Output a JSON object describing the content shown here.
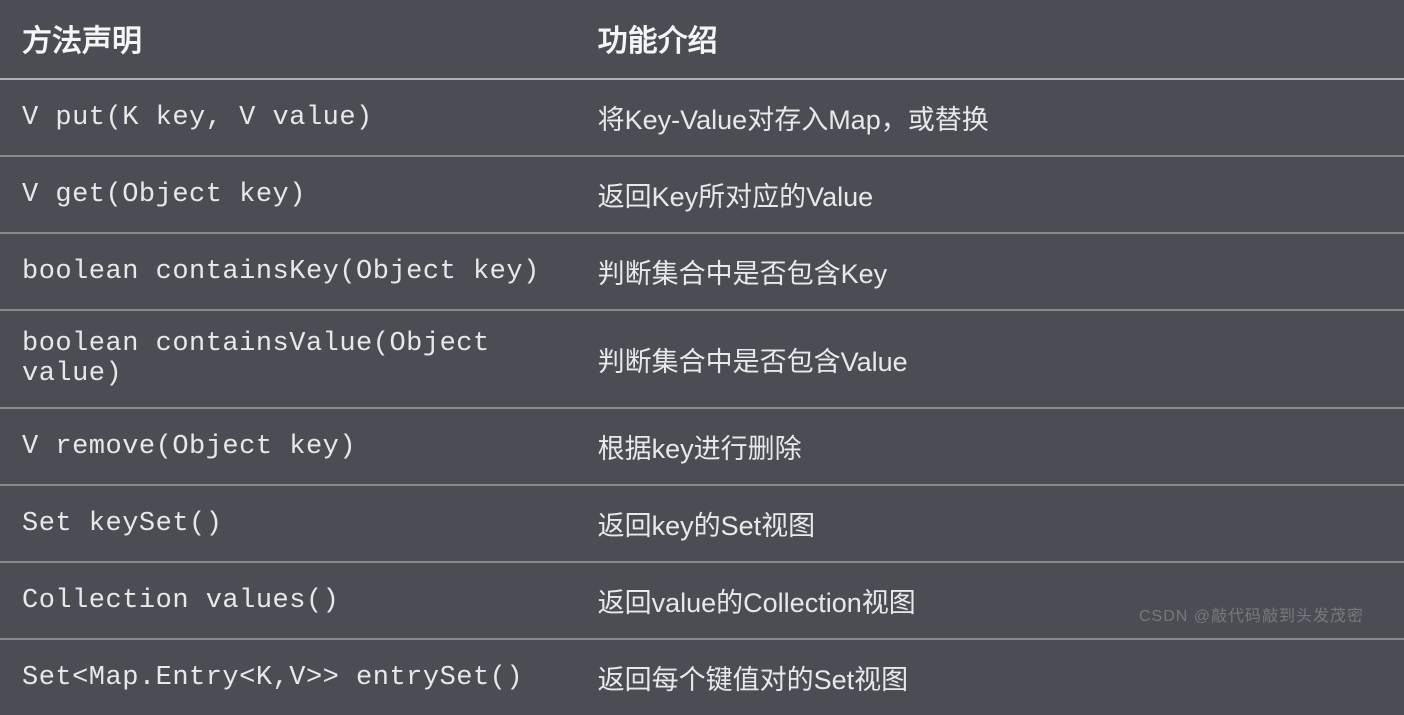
{
  "table": {
    "headers": {
      "method": "方法声明",
      "description": "功能介绍"
    },
    "rows": [
      {
        "method": "V put(K key, V value)",
        "description": "将Key-Value对存入Map，或替换"
      },
      {
        "method": "V get(Object key)",
        "description": "返回Key所对应的Value"
      },
      {
        "method": "boolean containsKey(Object key)",
        "description": "判断集合中是否包含Key"
      },
      {
        "method": "boolean containsValue(Object value)",
        "description": "判断集合中是否包含Value"
      },
      {
        "method": "V remove(Object key)",
        "description": "根据key进行删除"
      },
      {
        "method": "Set keySet()",
        "description": "返回key的Set视图"
      },
      {
        "method": "Collection values()",
        "description": "返回value的Collection视图"
      },
      {
        "method": "Set<Map.Entry<K,V>> entrySet()",
        "description": "返回每个键值对的Set视图"
      }
    ]
  },
  "watermark": "CSDN @敲代码敲到头发茂密"
}
